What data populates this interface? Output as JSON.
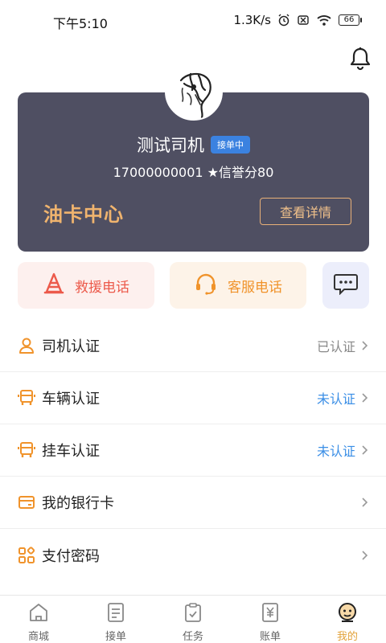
{
  "status_bar": {
    "time": "下午5:10",
    "network_speed": "1.3K/s",
    "battery": "66"
  },
  "header": {
    "bell_icon": "bell-icon"
  },
  "profile": {
    "name": "测试司机",
    "badge": "接单中",
    "phone": "17000000001",
    "credit_label": "★信誉分80",
    "oil_center_title": "油卡中心",
    "detail_button": "查看详情"
  },
  "quick_actions": {
    "rescue": "救援电话",
    "service": "客服电话",
    "message_icon": "chat-bubble-icon"
  },
  "menu": [
    {
      "name": "driver-auth",
      "label": "司机认证",
      "status": "已认证",
      "status_type": "done",
      "icon": "user-icon"
    },
    {
      "name": "vehicle-auth",
      "label": "车辆认证",
      "status": "未认证",
      "status_type": "todo",
      "icon": "truck-icon"
    },
    {
      "name": "trailer-auth",
      "label": "挂车认证",
      "status": "未认证",
      "status_type": "todo",
      "icon": "truck-icon"
    },
    {
      "name": "bank-card",
      "label": "我的银行卡",
      "status": "",
      "status_type": "",
      "icon": "card-icon"
    },
    {
      "name": "pay-password",
      "label": "支付密码",
      "status": "",
      "status_type": "",
      "icon": "grid-icon"
    }
  ],
  "bottom_nav": [
    {
      "label": "商城",
      "icon": "home-icon",
      "active": false
    },
    {
      "label": "接单",
      "icon": "list-icon",
      "active": false
    },
    {
      "label": "任务",
      "icon": "clipboard-icon",
      "active": false
    },
    {
      "label": "账单",
      "icon": "bill-icon",
      "active": false
    },
    {
      "label": "我的",
      "icon": "profile-icon",
      "active": true
    }
  ],
  "colors": {
    "card_bg": "#4f4f62",
    "accent_gold": "#f0b46e",
    "badge_blue": "#3b82e0",
    "rescue_red": "#ec5a4b",
    "service_orange": "#f0932b",
    "unverified_blue": "#3a8ee6",
    "nav_active": "#e2a23a"
  }
}
